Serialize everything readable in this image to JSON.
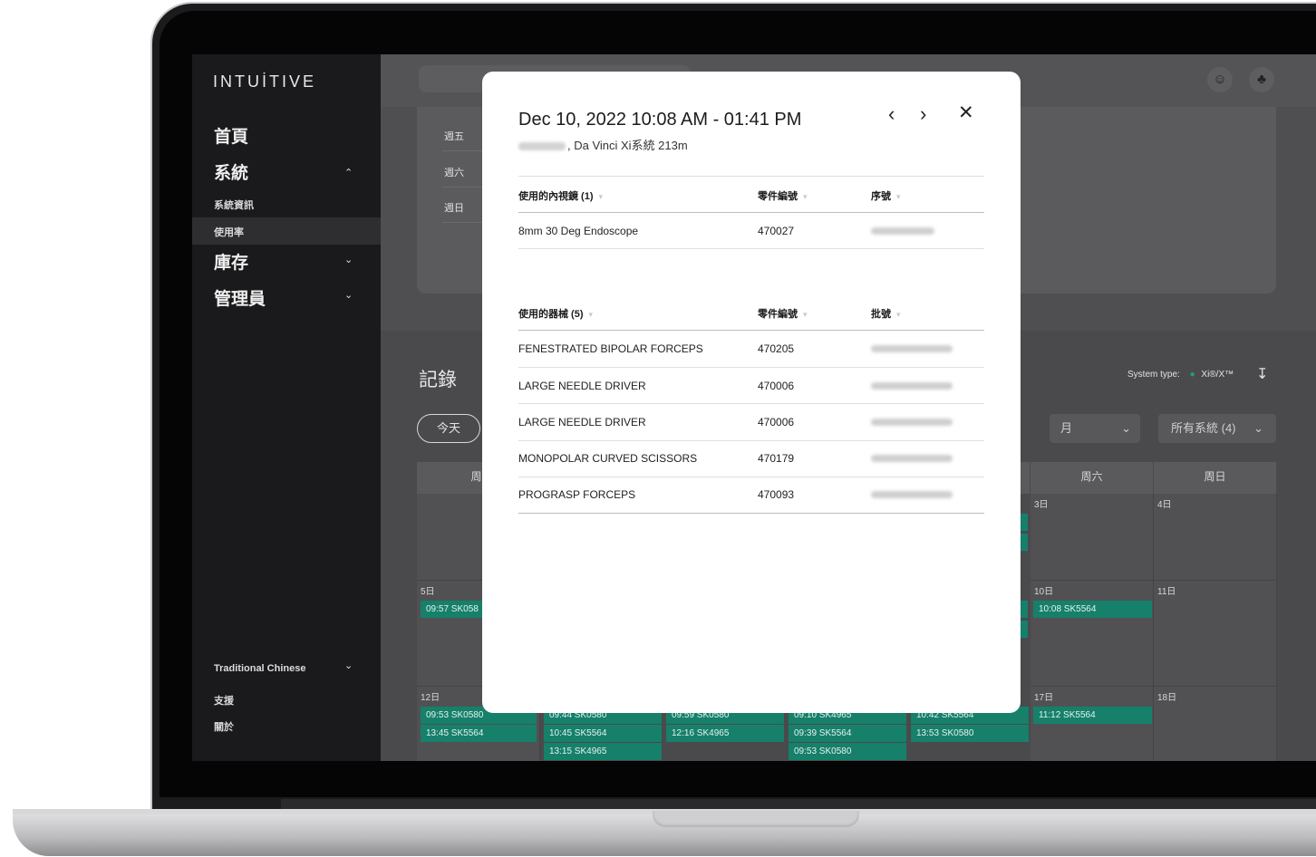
{
  "app": {
    "logo": "INTUİTIVE"
  },
  "sidebar": {
    "items": [
      {
        "label": "首頁"
      },
      {
        "label": "系統"
      },
      {
        "label": "系統資訊"
      },
      {
        "label": "使用率"
      },
      {
        "label": "庫存"
      },
      {
        "label": "管理員"
      }
    ],
    "language": "Traditional Chinese",
    "support": "支援",
    "about": "關於"
  },
  "panel": {
    "days": [
      "週五",
      "週六",
      "週日"
    ]
  },
  "records": {
    "title": "記錄",
    "today_label": "今天",
    "system_type_label": "System type:",
    "system_type_value": "Xi®/X™",
    "view_select": "月",
    "system_select": "所有系統 (4)",
    "weekday_headers": [
      "周-",
      "周六",
      "周日"
    ],
    "dates": [
      "3日",
      "4日",
      "5日",
      "10日",
      "11日",
      "12日",
      "17日",
      "18日"
    ],
    "events": [
      "09:57 SK058",
      "10:08 SK5564",
      "09:53 SK0580",
      "13:45 SK5564",
      "09:44 SK0580",
      "10:45 SK5564",
      "13:15 SK4965",
      "09:59 SK0580",
      "12:16 SK4965",
      "09:10 SK4965",
      "09:39 SK5564",
      "09:53 SK0580",
      "10:42 SK5564",
      "13:53 SK0580",
      "11:12 SK5564"
    ]
  },
  "modal": {
    "title": "Dec 10, 2022 10:08 AM - 01:41 PM",
    "subtitle": ", Da Vinci Xi系統 213m",
    "prev_icon": "chevron-left-icon",
    "next_icon": "chevron-right-icon",
    "close_icon": "close-icon",
    "endoscope_table": {
      "headers": [
        "使用的內視鏡 (1)",
        "零件編號",
        "序號"
      ],
      "rows": [
        {
          "name": "8mm 30 Deg Endoscope",
          "part": "470027"
        }
      ]
    },
    "instrument_table": {
      "headers": [
        "使用的器械 (5)",
        "零件編號",
        "批號"
      ],
      "rows": [
        {
          "name": "FENESTRATED BIPOLAR FORCEPS",
          "part": "470205"
        },
        {
          "name": "LARGE NEEDLE DRIVER",
          "part": "470006"
        },
        {
          "name": "LARGE NEEDLE DRIVER",
          "part": "470006"
        },
        {
          "name": "MONOPOLAR CURVED SCISSORS",
          "part": "470179"
        },
        {
          "name": "PROGRASP FORCEPS",
          "part": "470093"
        }
      ]
    }
  },
  "colors": {
    "accent_green": "#16806a",
    "sidebar_bg": "#1a1a1c"
  }
}
